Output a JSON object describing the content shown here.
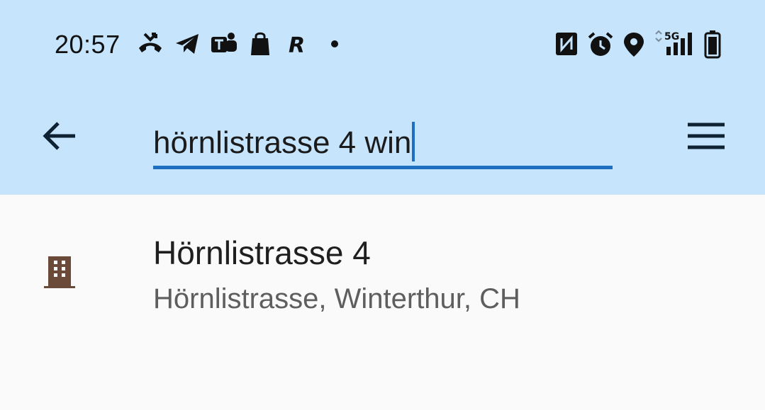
{
  "status_bar": {
    "time": "20:57",
    "left_icons": [
      "missed-call-icon",
      "telegram-icon",
      "teams-icon",
      "shopping-bag-icon",
      "r-app-icon",
      "dot-icon"
    ],
    "right_icons": [
      "nfc-icon",
      "alarm-icon",
      "location-icon",
      "5g-signal-icon",
      "battery-icon"
    ],
    "network_label": "5G"
  },
  "search": {
    "query": "hörnlistrasse 4 win"
  },
  "results": [
    {
      "icon": "building-icon",
      "title": "Hörnlistrasse 4",
      "subtitle": "Hörnlistrasse, Winterthur, CH"
    }
  ],
  "colors": {
    "header_bg": "#c6e4fc",
    "accent": "#1e6fc0",
    "body_bg": "#fafafa",
    "building_icon": "#6b4a3a"
  }
}
